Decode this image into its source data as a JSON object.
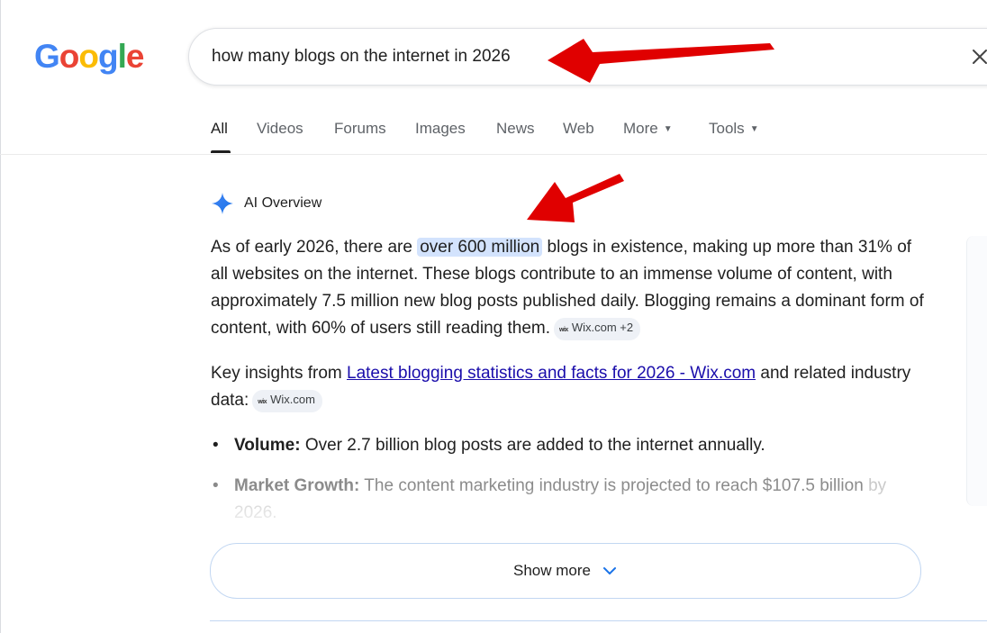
{
  "logo": {
    "letters": [
      "G",
      "o",
      "o",
      "g",
      "l",
      "e"
    ]
  },
  "search": {
    "query": "how many blogs on the internet in 2026"
  },
  "tabs": [
    {
      "label": "All"
    },
    {
      "label": "Videos"
    },
    {
      "label": "Forums"
    },
    {
      "label": "Images"
    },
    {
      "label": "News"
    },
    {
      "label": "Web"
    },
    {
      "label": "More"
    },
    {
      "label": "Tools"
    }
  ],
  "ai_overview": {
    "title": "AI Overview",
    "para1": {
      "before": "As of early 2026, there are ",
      "highlight": "over 600 million",
      "after": " blogs in existence, making up more than 31% of all websites on the internet. These blogs contribute to an immense volume of content, with approximately 7.5 million new blog posts published daily. Blogging remains a dominant form of content, with 60% of users still reading them.",
      "chip_logo": "wix",
      "chip": "Wix.com +2"
    },
    "para2": {
      "before": "Key insights from ",
      "link": "Latest blogging statistics and facts for 2026 - Wix.com",
      "after": " and related industry data:",
      "chip_logo": "wix",
      "chip": "Wix.com"
    },
    "bullets": [
      {
        "label": "Volume:",
        "text": " Over 2.7 billion blog posts are added to the internet annually."
      },
      {
        "label": "Market Growth:",
        "text": " The content marketing industry is projected to reach $107.5 billion",
        "tail": "by 2026."
      }
    ],
    "show_more": "Show more"
  },
  "colors": {
    "highlight": "#d3e3fd",
    "link": "#1a0dab",
    "arrow": "#e00000"
  },
  "icons": {
    "clear": "close-icon",
    "sparkle": "gemini-sparkle-icon",
    "chevron": "chevron-down-icon"
  }
}
